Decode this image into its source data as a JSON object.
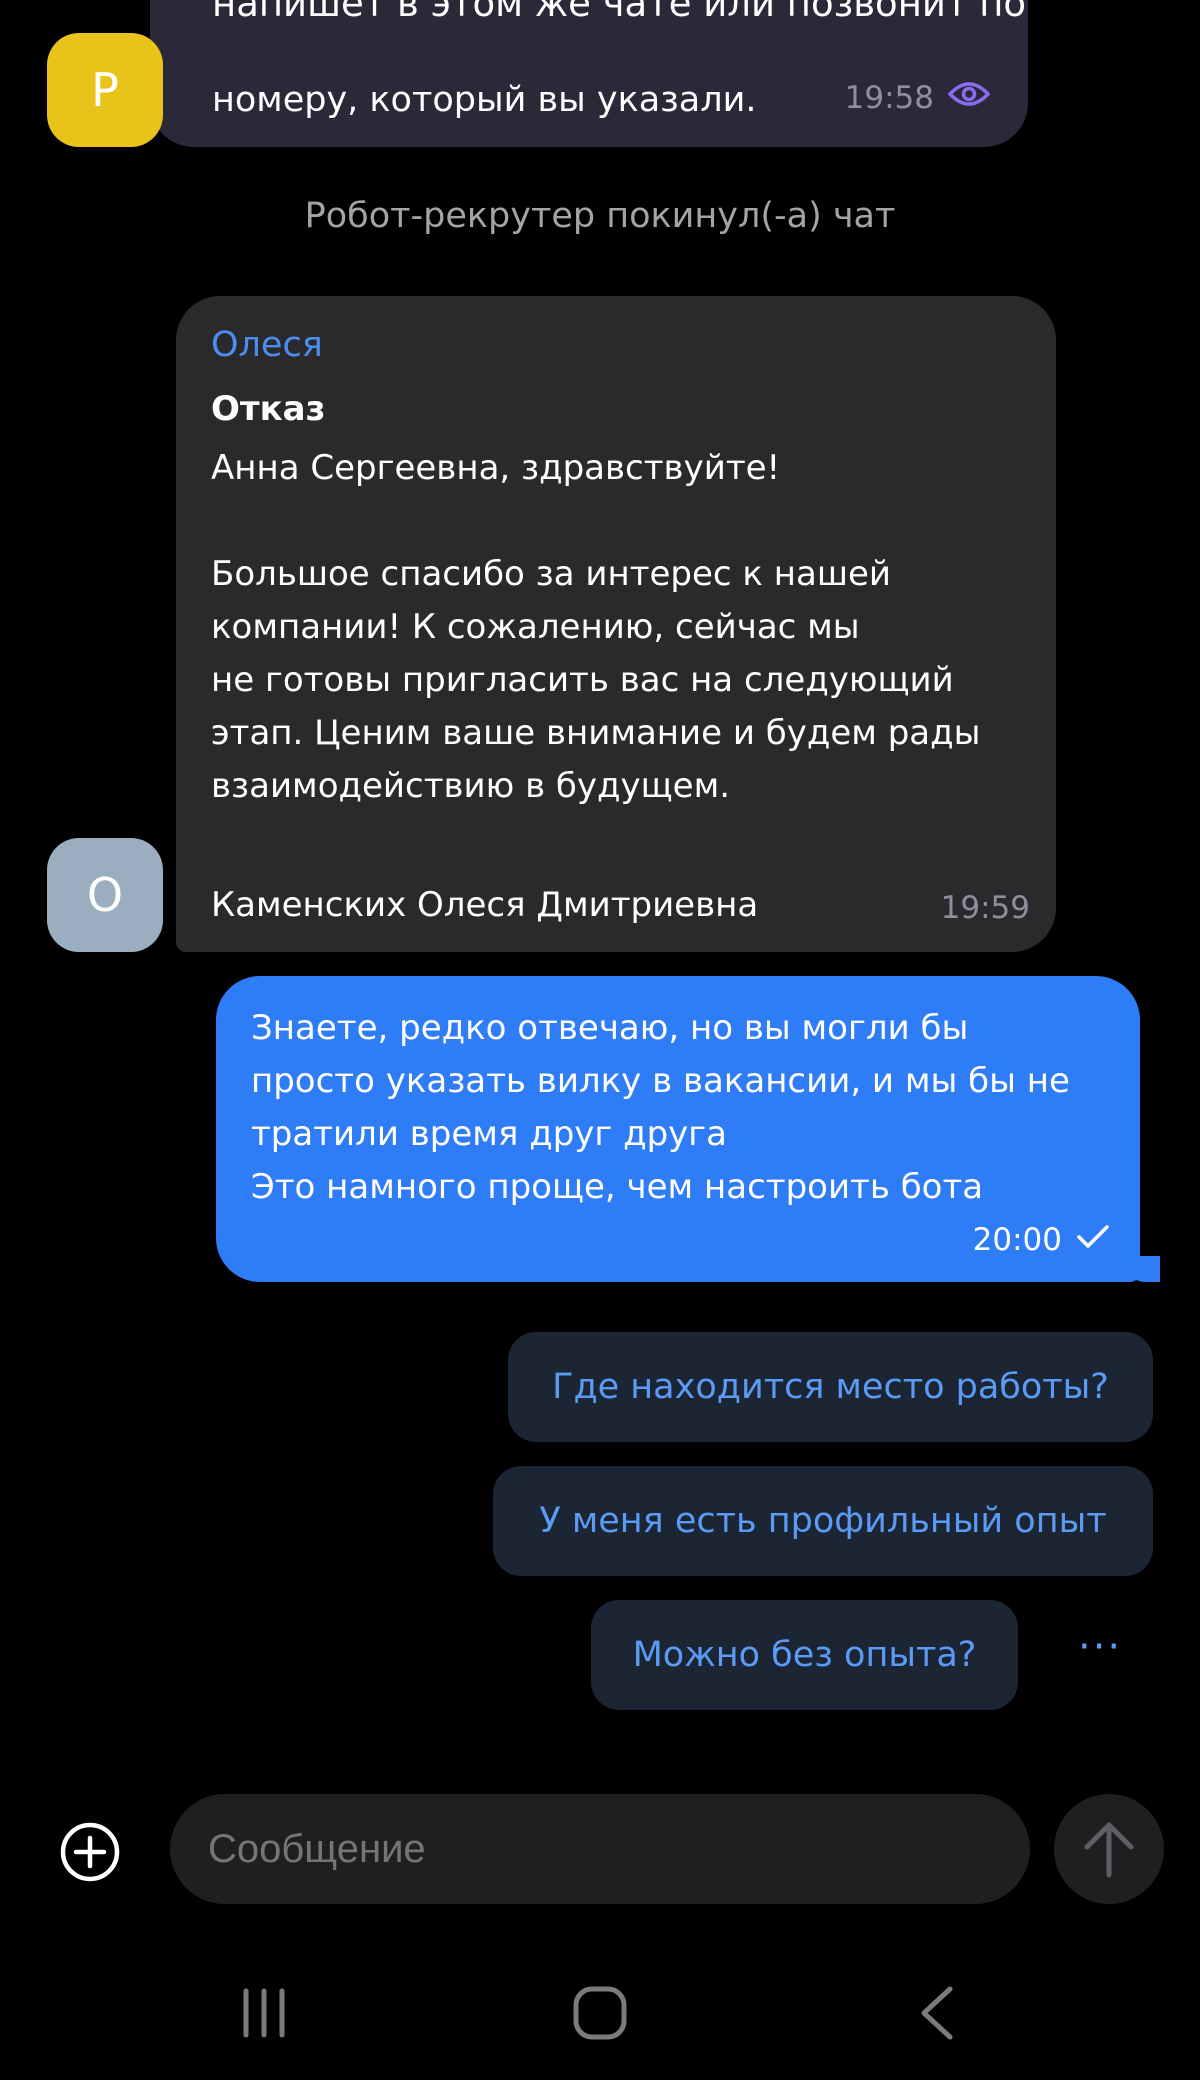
{
  "top_message": {
    "avatar_letter": "Р",
    "cut_text": "напишет в этом же чате или позвонит по",
    "text": "номеру, который вы указали.",
    "time": "19:58",
    "status_icon": "eye-icon"
  },
  "system_message": "Робот-рекрутер покинул(-а) чат",
  "incoming_message": {
    "avatar_letter": "О",
    "sender": "Олеся",
    "subject": "Отказ",
    "greeting": "Анна Сергеевна, здравствуйте!",
    "body": "Большое спасибо за интерес к нашей\nкомпании! К сожалению, сейчас мы\nне готовы пригласить вас на следующий\nэтап. Ценим ваше внимание и будем рады\nвзаимодействию в будущем.",
    "signature": "Каменских Олеся Дмитриевна",
    "time": "19:59"
  },
  "outgoing_message": {
    "text": "Знаете, редко отвечаю, но вы могли бы\nпросто указать вилку в вакансии, и мы бы не\nтратили время друг друга\nЭто намного проще, чем настроить бота",
    "time": "20:00",
    "status_icon": "check-icon"
  },
  "quick_replies": [
    {
      "label": "Где находится место работы?"
    },
    {
      "label": "У меня есть профильный опыт"
    },
    {
      "label": "Можно без опыта?"
    }
  ],
  "more_label": "···",
  "composer": {
    "placeholder": "Сообщение"
  },
  "colors": {
    "background": "#000000",
    "outgoing_bubble": "#2f7df6",
    "incoming_bubble": "#2a2a2c",
    "accent": "#5b9bf5",
    "avatar_robot": "#e8c41a",
    "avatar_olesya": "#9aaebf"
  }
}
